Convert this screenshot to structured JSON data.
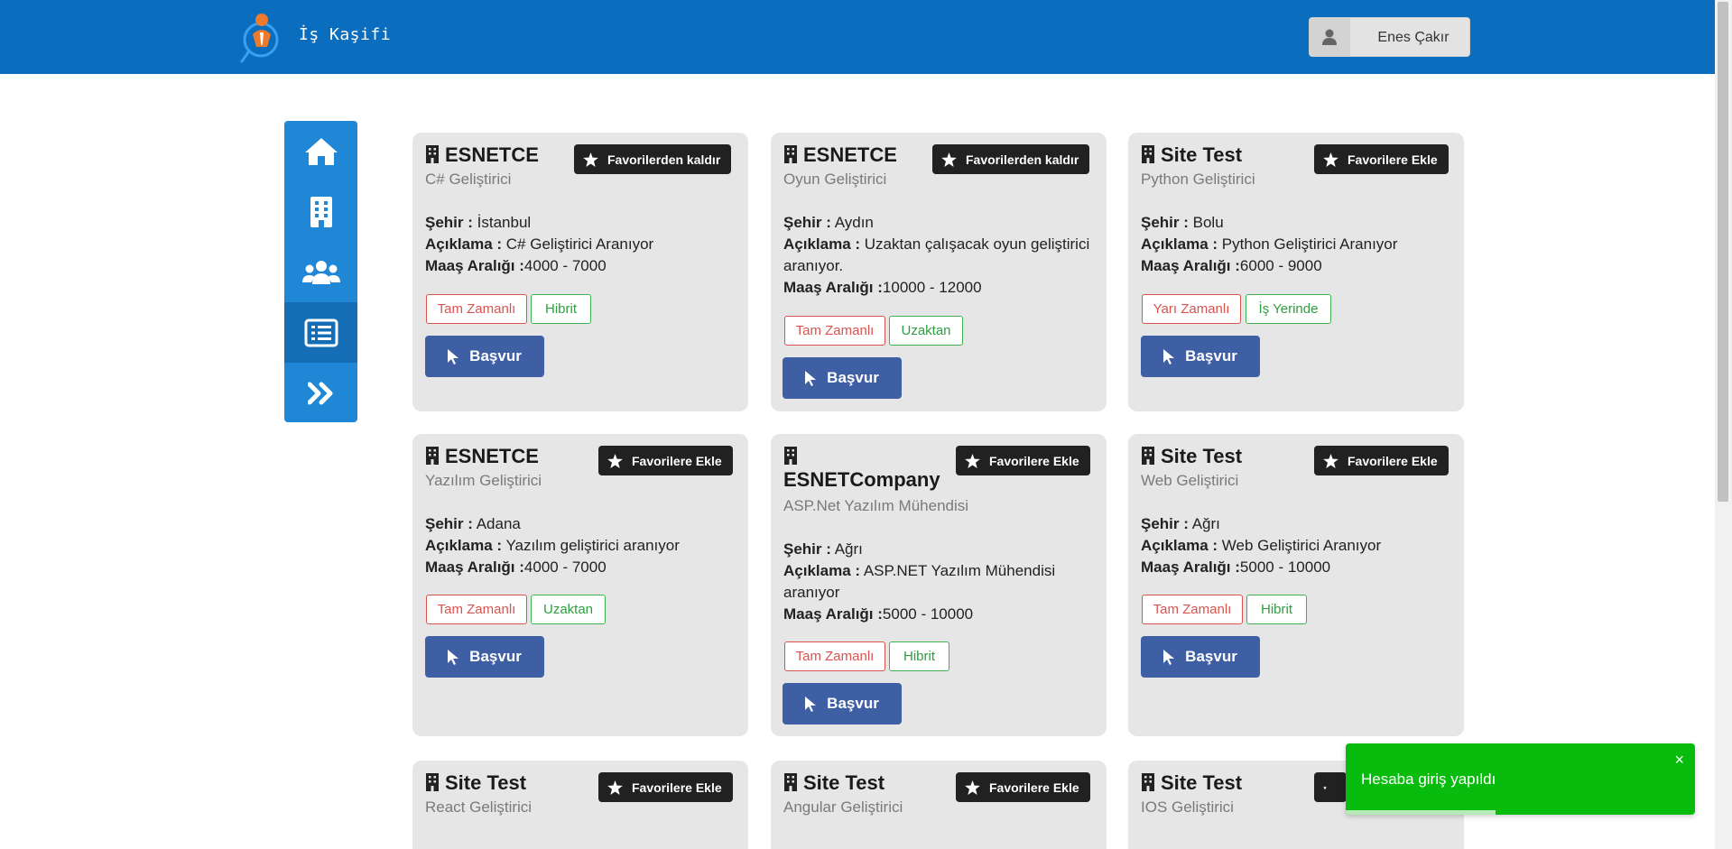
{
  "header": {
    "app_title": "İş Kaşifi",
    "user_name": "Enes Çakır"
  },
  "sidebar": {
    "items": [
      {
        "icon": "home-icon",
        "active": false
      },
      {
        "icon": "building-icon",
        "active": false
      },
      {
        "icon": "users-icon",
        "active": false
      },
      {
        "icon": "list-icon",
        "active": true
      },
      {
        "icon": "double-chevron-right-icon",
        "active": false
      }
    ]
  },
  "labels": {
    "city": "Şehir :",
    "description": "Açıklama :",
    "salary": "Maaş Aralığı :",
    "apply": "Başvur"
  },
  "jobs": [
    {
      "company": "ESNETCE",
      "position": "C# Geliştirici",
      "fav_label": "Favorilerden kaldır",
      "city": "İstanbul",
      "description": "C# Geliştirici Aranıyor",
      "salary": "4000 - 7000",
      "type": "Tam Zamanlı",
      "mode": "Hibrit"
    },
    {
      "company": "ESNETCE",
      "position": "Oyun Geliştirici",
      "fav_label": "Favorilerden kaldır",
      "city": "Aydın",
      "description": "Uzaktan çalışacak oyun geliştirici aranıyor.",
      "salary": "10000 - 12000",
      "type": "Tam Zamanlı",
      "mode": "Uzaktan"
    },
    {
      "company": "Site Test",
      "position": "Python Geliştirici",
      "fav_label": "Favorilere Ekle",
      "city": "Bolu",
      "description": "Python Geliştirici Aranıyor",
      "salary": "6000 - 9000",
      "type": "Yarı Zamanlı",
      "mode": "İş Yerinde"
    },
    {
      "company": "ESNETCE",
      "position": "Yazılım Geliştirici",
      "fav_label": "Favorilere Ekle",
      "city": "Adana",
      "description": "Yazılım geliştirici aranıyor",
      "salary": "4000 - 7000",
      "type": "Tam Zamanlı",
      "mode": "Uzaktan"
    },
    {
      "company": "ESNETCompany",
      "position": "ASP.Net Yazılım Mühendisi",
      "fav_label": "Favorilere Ekle",
      "city": "Ağrı",
      "description": "ASP.NET Yazılım Mühendisi aranıyor",
      "salary": "5000 - 10000",
      "type": "Tam Zamanlı",
      "mode": "Hibrit"
    },
    {
      "company": "Site Test",
      "position": "Web Geliştirici",
      "fav_label": "Favorilere Ekle",
      "city": "Ağrı",
      "description": "Web Geliştirici Aranıyor",
      "salary": "5000 - 10000",
      "type": "Tam Zamanlı",
      "mode": "Hibrit"
    },
    {
      "company": "Site Test",
      "position": "React Geliştirici",
      "fav_label": "Favorilere Ekle"
    },
    {
      "company": "Site Test",
      "position": "Angular Geliştirici",
      "fav_label": "Favorilere Ekle"
    },
    {
      "company": "Site Test",
      "position": "IOS Geliştirici"
    }
  ],
  "toast": {
    "message": "Hesaba giriş yapıldı",
    "close": "×",
    "progress": 0.43
  },
  "colors": {
    "header": "#0a6dbd",
    "sidebar": "#1f87d6",
    "apply_button": "#3e5fa4",
    "toast": "#07bc0c"
  }
}
